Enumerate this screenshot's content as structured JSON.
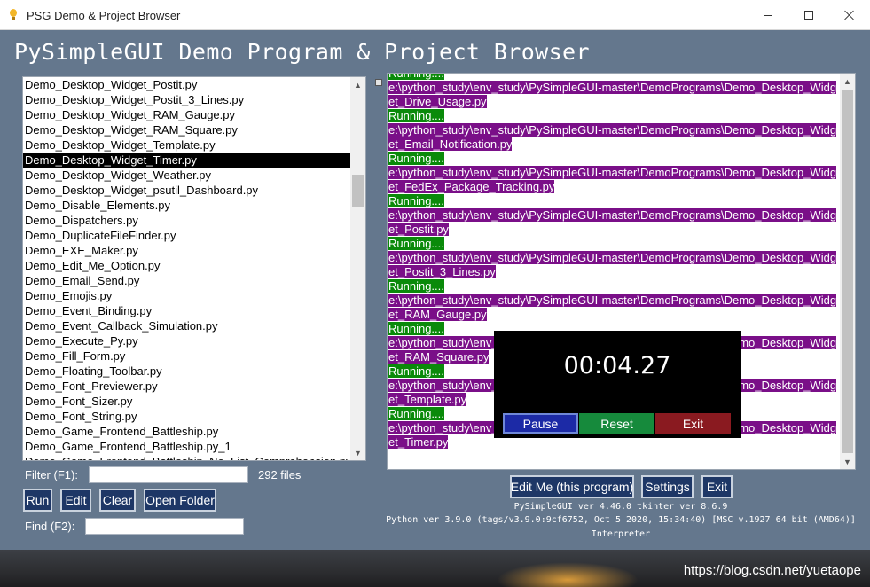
{
  "window": {
    "title": "PSG Demo & Project Browser"
  },
  "header": {
    "title": "PySimpleGUI Demo Program & Project Browser"
  },
  "file_list": {
    "items": [
      "Demo_Desktop_Widget_Postit.py",
      "Demo_Desktop_Widget_Postit_3_Lines.py",
      "Demo_Desktop_Widget_RAM_Gauge.py",
      "Demo_Desktop_Widget_RAM_Square.py",
      "Demo_Desktop_Widget_Template.py",
      "Demo_Desktop_Widget_Timer.py",
      "Demo_Desktop_Widget_Weather.py",
      "Demo_Desktop_Widget_psutil_Dashboard.py",
      "Demo_Disable_Elements.py",
      "Demo_Dispatchers.py",
      "Demo_DuplicateFileFinder.py",
      "Demo_EXE_Maker.py",
      "Demo_Edit_Me_Option.py",
      "Demo_Email_Send.py",
      "Demo_Emojis.py",
      "Demo_Event_Binding.py",
      "Demo_Event_Callback_Simulation.py",
      "Demo_Execute_Py.py",
      "Demo_Fill_Form.py",
      "Demo_Floating_Toolbar.py",
      "Demo_Font_Previewer.py",
      "Demo_Font_Sizer.py",
      "Demo_Font_String.py",
      "Demo_Game_Frontend_Battleship.py",
      "Demo_Game_Frontend_Battleship.py_1",
      "Demo_Game_Frontend_Battleship_No_List_Comprehension.py"
    ],
    "selected_index": 5
  },
  "filter": {
    "label": "Filter (F1):",
    "value": "",
    "count_text": "292 files"
  },
  "buttons": {
    "run": "Run",
    "edit": "Edit",
    "clear": "Clear",
    "open_folder": "Open Folder"
  },
  "find": {
    "label": "Find (F2):",
    "value": ""
  },
  "output": {
    "lines": [
      {
        "kind": "run",
        "text": "Running...."
      },
      {
        "kind": "path",
        "text": "e:\\python_study\\env_study\\PySimpleGUI-master\\DemoPrograms\\Demo_Desktop_Widg"
      },
      {
        "kind": "path",
        "text": "et_Drive_Usage.py"
      },
      {
        "kind": "run",
        "text": "Running...."
      },
      {
        "kind": "path",
        "text": "e:\\python_study\\env_study\\PySimpleGUI-master\\DemoPrograms\\Demo_Desktop_Widg"
      },
      {
        "kind": "path",
        "text": "et_Email_Notification.py"
      },
      {
        "kind": "run",
        "text": "Running...."
      },
      {
        "kind": "path",
        "text": "e:\\python_study\\env_study\\PySimpleGUI-master\\DemoPrograms\\Demo_Desktop_Widg"
      },
      {
        "kind": "path",
        "text": "et_FedEx_Package_Tracking.py"
      },
      {
        "kind": "run",
        "text": "Running...."
      },
      {
        "kind": "path",
        "text": "e:\\python_study\\env_study\\PySimpleGUI-master\\DemoPrograms\\Demo_Desktop_Widg"
      },
      {
        "kind": "path",
        "text": "et_Postit.py"
      },
      {
        "kind": "run",
        "text": "Running...."
      },
      {
        "kind": "path",
        "text": "e:\\python_study\\env_study\\PySimpleGUI-master\\DemoPrograms\\Demo_Desktop_Widg"
      },
      {
        "kind": "path",
        "text": "et_Postit_3_Lines.py"
      },
      {
        "kind": "run",
        "text": "Running...."
      },
      {
        "kind": "path",
        "text": "e:\\python_study\\env_study\\PySimpleGUI-master\\DemoPrograms\\Demo_Desktop_Widg"
      },
      {
        "kind": "path",
        "text": "et_RAM_Gauge.py"
      },
      {
        "kind": "run",
        "text": "Running...."
      },
      {
        "kind": "path",
        "text": "e:\\python_study\\env_study\\PySimpleGUI-master\\DemoPrograms\\Demo_Desktop_Widg"
      },
      {
        "kind": "path",
        "text": "et_RAM_Square.py"
      },
      {
        "kind": "run",
        "text": "Running...."
      },
      {
        "kind": "path",
        "text": "e:\\python_study\\env_study\\PySimpleGUI-master\\DemoPrograms\\Demo_Desktop_Widg"
      },
      {
        "kind": "path",
        "text": "et_Template.py"
      },
      {
        "kind": "run",
        "text": "Running...."
      },
      {
        "kind": "path",
        "text": "e:\\python_study\\env_study\\PySimpleGUI-master\\DemoPrograms\\Demo_Desktop_Widg"
      },
      {
        "kind": "path",
        "text": "et_Timer.py"
      }
    ]
  },
  "timer_widget": {
    "time": "00:04.27",
    "pause": "Pause",
    "reset": "Reset",
    "exit": "Exit"
  },
  "actions": {
    "edit_me": "Edit Me (this program)",
    "settings": "Settings",
    "exit": "Exit"
  },
  "version_info": {
    "line1": "PySimpleGUI ver 4.46.0  tkinter ver 8.6.9",
    "line2": "Python ver 3.9.0 (tags/v3.9.0:9cf6752, Oct  5 2020, 15:34:40) [MSC v.1927 64 bit (AMD64)]",
    "line3": "Interpreter"
  },
  "watermark": "https://blog.csdn.net/yuetaope",
  "colors": {
    "window_bg": "#64778d",
    "button_bg": "#1e3766",
    "running_bg": "#0a8a0a",
    "path_bg": "#7a0f88",
    "pause_bg": "#1c2aa6",
    "reset_bg": "#168a3c",
    "exit_bg": "#8a1a20"
  }
}
